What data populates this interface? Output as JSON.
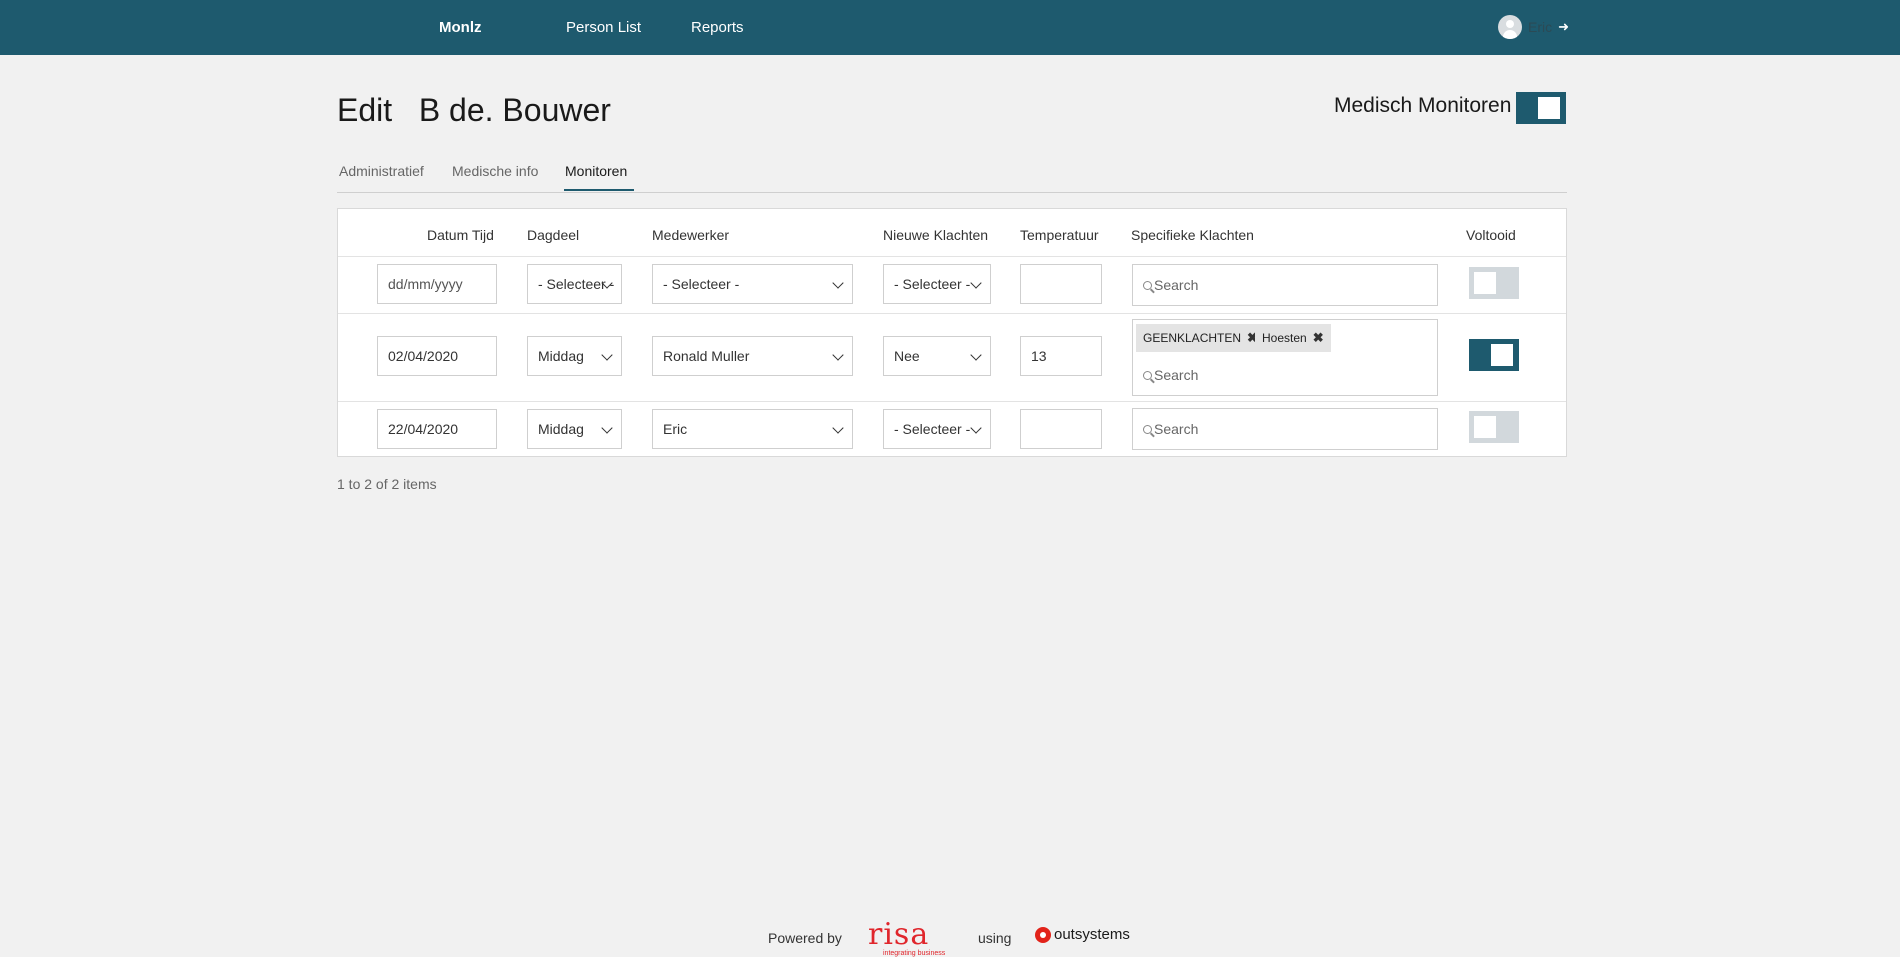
{
  "header": {
    "brand": "Monlz",
    "nav": [
      "Person List",
      "Reports"
    ],
    "user_name": "Eric"
  },
  "page": {
    "title": "Edit   B de. Bouwer",
    "monitor_label": "Medisch Monitoren",
    "monitor_enabled": true
  },
  "tabs": [
    {
      "label": "Administratief",
      "active": false
    },
    {
      "label": "Medische info",
      "active": false
    },
    {
      "label": "Monitoren",
      "active": true
    }
  ],
  "table": {
    "columns": [
      "Datum Tijd",
      "Dagdeel",
      "Medewerker",
      "Nieuwe Klachten",
      "Temperatuur",
      "Specifieke Klachten",
      "Voltooid"
    ],
    "search_placeholder": "Search",
    "new_row": {
      "date_placeholder": "dd/mm/yyyy",
      "dagdeel": "- Selecteer -",
      "medewerker": "- Selecteer -",
      "nieuwe_klachten": "- Selecteer -",
      "temperatuur": "",
      "voltooid": false
    },
    "rows": [
      {
        "date": "02/04/2020",
        "dagdeel": "Middag",
        "medewerker": "Ronald Muller",
        "nieuwe_klachten": "Nee",
        "temperatuur": "13",
        "tags": [
          "GEENKLACHTEN",
          "Hoesten"
        ],
        "voltooid": true
      },
      {
        "date": "22/04/2020",
        "dagdeel": "Middag",
        "medewerker": "Eric",
        "nieuwe_klachten": "- Selecteer -",
        "temperatuur": "",
        "tags": [],
        "voltooid": false
      }
    ],
    "count_text": "1 to 2 of 2 items"
  },
  "footer": {
    "powered_by": "Powered by",
    "risa": "risa",
    "risa_tagline": "integrating business",
    "using": "using",
    "outsystems": "outsystems"
  },
  "colors": {
    "header_bg": "#1e5a6e",
    "accent": "#1e5a6e",
    "page_bg": "#f1f1f1",
    "risa_red": "#e0262c"
  }
}
